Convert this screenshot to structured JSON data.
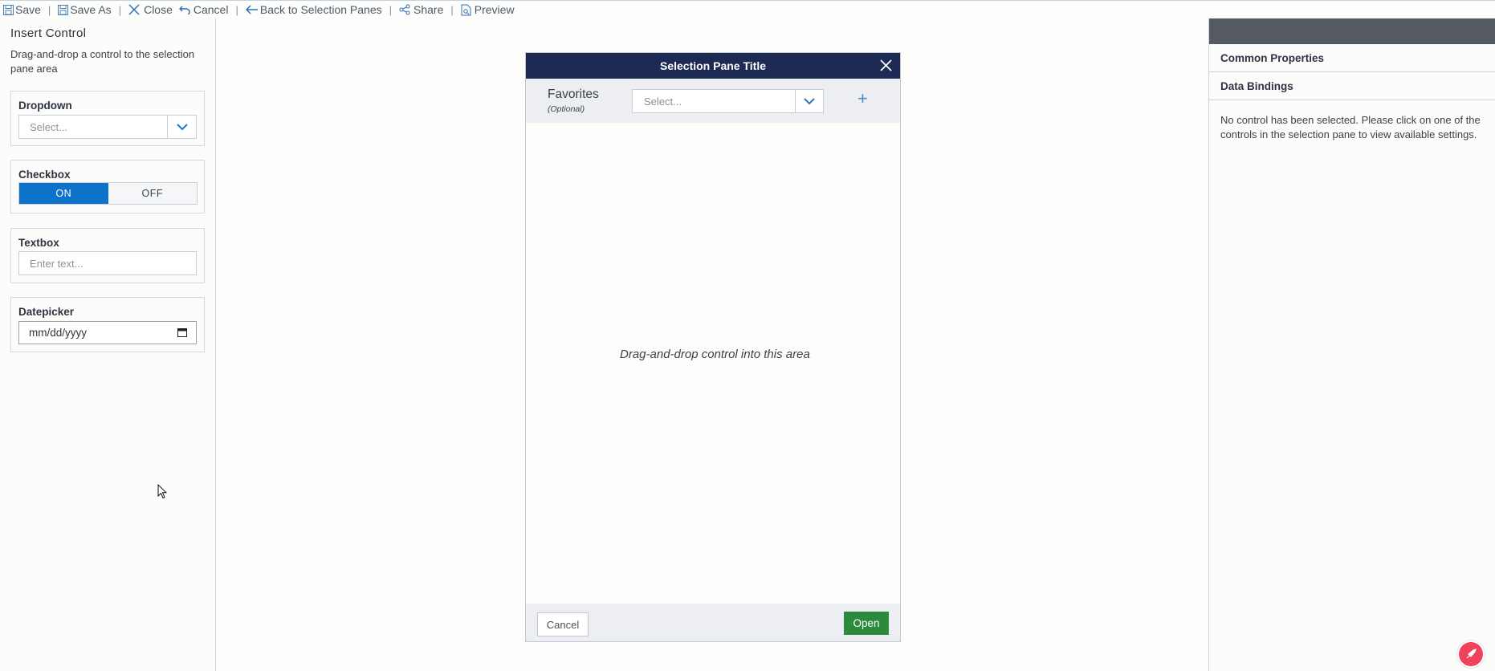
{
  "toolbar": {
    "save": "Save",
    "save_as": "Save As",
    "close": "Close",
    "cancel": "Cancel",
    "back": "Back to Selection Panes",
    "share": "Share",
    "preview": "Preview",
    "separator": "|"
  },
  "insert_control": {
    "title": "Insert Control",
    "hint": "Drag-and-drop a control to the selection pane area",
    "dropdown": {
      "label": "Dropdown",
      "placeholder": "Select..."
    },
    "checkbox": {
      "label": "Checkbox",
      "on": "ON",
      "off": "OFF",
      "selected": "ON"
    },
    "textbox": {
      "label": "Textbox",
      "placeholder": "Enter text..."
    },
    "datepicker": {
      "label": "Datepicker",
      "placeholder": "mm/dd/yyyy"
    }
  },
  "modal": {
    "title": "Selection Pane Title",
    "favorites": {
      "label": "Favorites",
      "optional": "(Optional)",
      "placeholder": "Select...",
      "add": "+"
    },
    "drop_hint": "Drag-and-drop control into this area",
    "cancel": "Cancel",
    "open": "Open"
  },
  "properties": {
    "common": "Common Properties",
    "bindings": "Data Bindings",
    "message": "No control has been selected. Please click on one of the controls in the selection pane to view available settings."
  },
  "colors": {
    "accent": "#0d72c9",
    "modal_title_bg": "#1d2a54",
    "open_button": "#2b8a3e",
    "fab": "#f0425d"
  }
}
